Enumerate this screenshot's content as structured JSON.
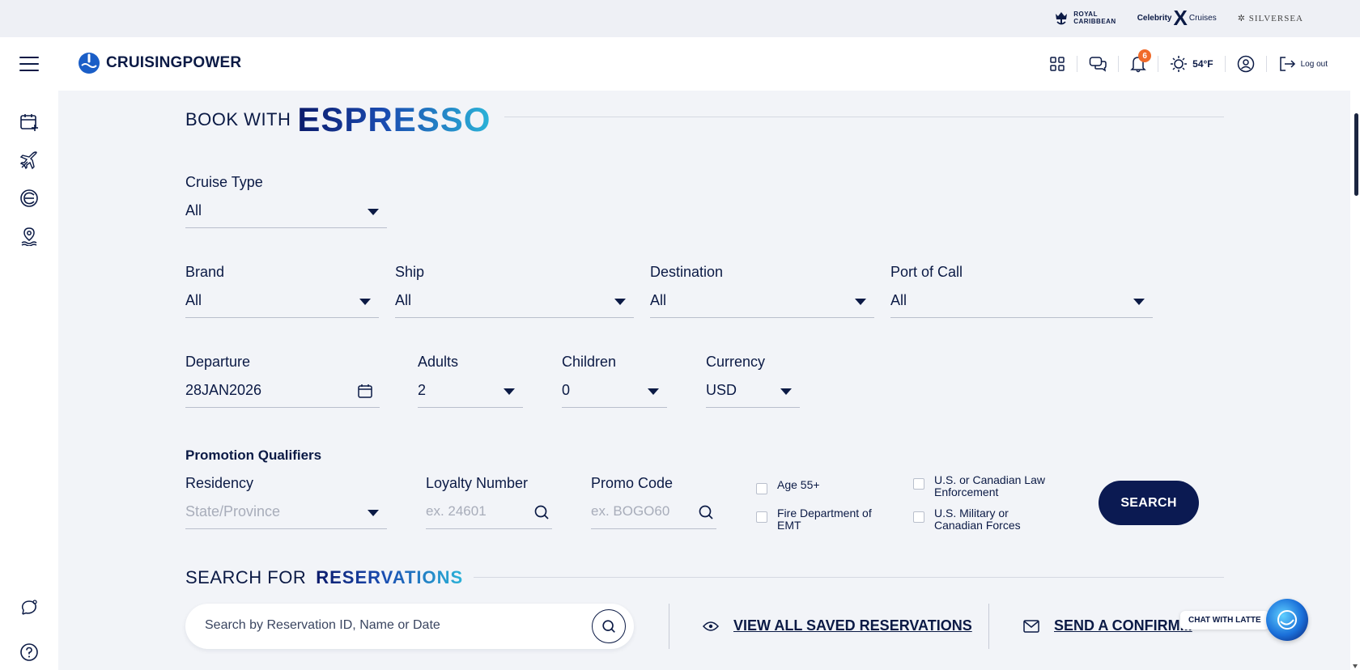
{
  "topbar": {
    "brands": {
      "royal_caribbean": "ROYAL\nCARIBBEAN",
      "celebrity_prefix": "Celebrity",
      "celebrity_x": "X",
      "celebrity_suffix": "Cruises",
      "silversea": "SILVERSEA"
    }
  },
  "header": {
    "logo_text": "CRUISINGPOWER",
    "notification_count": "6",
    "temperature": "54°F",
    "logout_label": "Log out",
    "icons": [
      "apps-grid-icon",
      "chat-bubbles-icon",
      "bell-icon",
      "sun-icon",
      "user-circle-icon",
      "logout-icon"
    ]
  },
  "sidebar": {
    "icons": [
      "calendar-plus-icon",
      "airplane-icon",
      "celebrity-e-icon",
      "map-pin-water-icon",
      "chat-feedback-icon",
      "help-icon"
    ]
  },
  "book": {
    "title_light": "BOOK WITH",
    "title_strong": "ESPRESSO",
    "cruise_type": {
      "label": "Cruise Type",
      "value": "All"
    },
    "brand": {
      "label": "Brand",
      "value": "All"
    },
    "ship": {
      "label": "Ship",
      "value": "All"
    },
    "destination": {
      "label": "Destination",
      "value": "All"
    },
    "port_of_call": {
      "label": "Port of Call",
      "value": "All"
    },
    "departure": {
      "label": "Departure",
      "value": "28JAN2026"
    },
    "adults": {
      "label": "Adults",
      "value": "2"
    },
    "children": {
      "label": "Children",
      "value": "0"
    },
    "currency": {
      "label": "Currency",
      "value": "USD"
    },
    "promo_title": "Promotion Qualifiers",
    "residency": {
      "label": "Residency",
      "placeholder": "State/Province"
    },
    "loyalty": {
      "label": "Loyalty Number",
      "placeholder": "ex. 24601"
    },
    "promo_code": {
      "label": "Promo Code",
      "placeholder": "ex. BOGO60"
    },
    "checkboxes": {
      "age55": "Age 55+",
      "fire": "Fire Department of EMT",
      "law": "U.S. or Canadian Law Enforcement",
      "military": "U.S. Military or Canadian Forces"
    },
    "search_label": "SEARCH"
  },
  "reservations": {
    "title_light": "SEARCH FOR",
    "title_strong": "RESERVATIONS",
    "search_placeholder": "Search by Reservation ID, Name or Date",
    "view_saved": "VIEW ALL SAVED RESERVATIONS",
    "send_confirm": "SEND A CONFIRM..."
  },
  "chat": {
    "label": "CHAT WITH LATTE"
  }
}
